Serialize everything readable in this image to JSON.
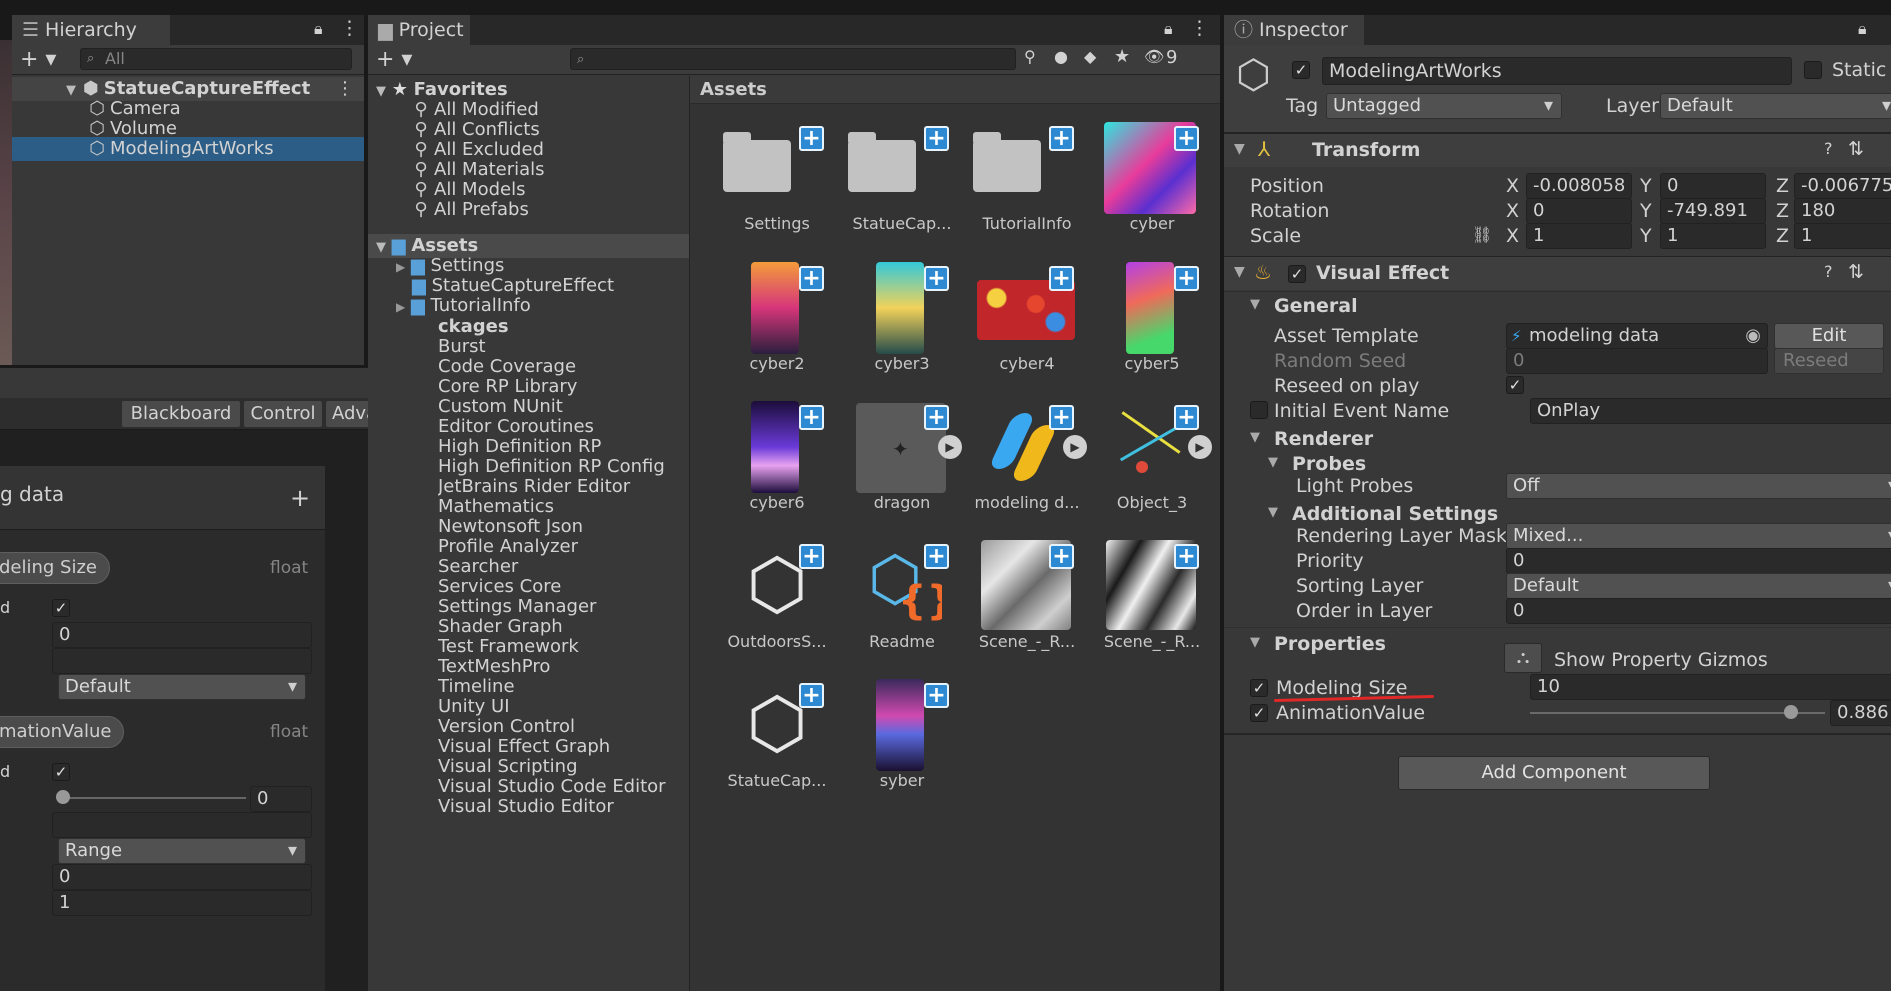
{
  "hierarchy": {
    "tab_label": "Hierarchy",
    "search_placeholder": "All",
    "scene_root": "StatueCaptureEffect",
    "items": [
      "Camera",
      "Volume",
      "ModelingArtWorks"
    ]
  },
  "project": {
    "tab_label": "Project",
    "hidden_count": "9",
    "favorites_label": "Favorites",
    "favorites": [
      "All Modified",
      "All Conflicts",
      "All Excluded",
      "All Materials",
      "All Models",
      "All Prefabs"
    ],
    "assets_label": "Assets",
    "asset_folders": [
      "Settings",
      "StatueCaptureEffect",
      "TutorialInfo"
    ],
    "packages_label": "ckages",
    "packages": [
      "Burst",
      "Code Coverage",
      "Core RP Library",
      "Custom NUnit",
      "Editor Coroutines",
      "High Definition RP",
      "High Definition RP Config",
      "JetBrains Rider Editor",
      "Mathematics",
      "Newtonsoft Json",
      "Profile Analyzer",
      "Searcher",
      "Services Core",
      "Settings Manager",
      "Shader Graph",
      "Test Framework",
      "TextMeshPro",
      "Timeline",
      "Unity UI",
      "Version Control",
      "Visual Effect Graph",
      "Visual Scripting",
      "Visual Studio Code Editor",
      "Visual Studio Editor"
    ],
    "grid_header": "Assets",
    "assets": [
      {
        "label": "Settings",
        "kind": "folder"
      },
      {
        "label": "StatueCap...",
        "kind": "folder"
      },
      {
        "label": "TutorialInfo",
        "kind": "folder"
      },
      {
        "label": "cyber",
        "kind": "image"
      },
      {
        "label": "cyber2",
        "kind": "image"
      },
      {
        "label": "cyber3",
        "kind": "image"
      },
      {
        "label": "cyber4",
        "kind": "image"
      },
      {
        "label": "cyber5",
        "kind": "image"
      },
      {
        "label": "cyber6",
        "kind": "image"
      },
      {
        "label": "dragon",
        "kind": "model"
      },
      {
        "label": "modeling d...",
        "kind": "vfx"
      },
      {
        "label": "Object_3",
        "kind": "model"
      },
      {
        "label": "OutdoorsS...",
        "kind": "scene"
      },
      {
        "label": "Readme",
        "kind": "readme"
      },
      {
        "label": "Scene_-_R...",
        "kind": "image"
      },
      {
        "label": "Scene_-_R...",
        "kind": "image"
      },
      {
        "label": "StatueCap...",
        "kind": "scene"
      },
      {
        "label": "syber",
        "kind": "image"
      }
    ]
  },
  "blackboard": {
    "tabs": [
      "Blackboard",
      "Control",
      "Advanced"
    ],
    "title": "g data",
    "prop1": {
      "name": "deling Size",
      "type": "float",
      "row_label": "d",
      "value": "0",
      "mode": "Default"
    },
    "prop2": {
      "name": "mationValue",
      "type": "float",
      "row_label": "d",
      "slider_value": "0",
      "mode": "Range",
      "min": "0",
      "max": "1"
    }
  },
  "inspector": {
    "tab_label": "Inspector",
    "object_name": "ModelingArtWorks",
    "static_label": "Static",
    "tag_label": "Tag",
    "tag_value": "Untagged",
    "layer_label": "Layer",
    "layer_value": "Default",
    "transform": {
      "title": "Transform",
      "position_label": "Position",
      "position": [
        "-0.008058",
        "0",
        "-0.006775"
      ],
      "rotation_label": "Rotation",
      "rotation": [
        "0",
        "-749.891",
        "180"
      ],
      "scale_label": "Scale",
      "scale": [
        "1",
        "1",
        "1"
      ]
    },
    "vfx": {
      "title": "Visual Effect",
      "general_label": "General",
      "asset_template_label": "Asset Template",
      "asset_template_value": "modeling data",
      "edit_label": "Edit",
      "random_seed_label": "Random Seed",
      "random_seed_value": "0",
      "reseed_label": "Reseed",
      "reseed_on_play_label": "Reseed on play",
      "initial_event_label": "Initial Event Name",
      "initial_event_value": "OnPlay",
      "renderer_label": "Renderer",
      "probes_label": "Probes",
      "light_probes_label": "Light Probes",
      "light_probes_value": "Off",
      "additional_label": "Additional Settings",
      "rendering_layer_label": "Rendering Layer Mask",
      "rendering_layer_value": "Mixed...",
      "priority_label": "Priority",
      "priority_value": "0",
      "sorting_layer_label": "Sorting Layer",
      "sorting_layer_value": "Default",
      "order_label": "Order in Layer",
      "order_value": "0",
      "properties_label": "Properties",
      "gizmos_label": "Show Property Gizmos",
      "modeling_size_label": "Modeling Size",
      "modeling_size_value": "10",
      "animation_label": "AnimationValue",
      "animation_value": "0.886",
      "animation_fraction": 0.886
    },
    "add_component": "Add Component"
  }
}
